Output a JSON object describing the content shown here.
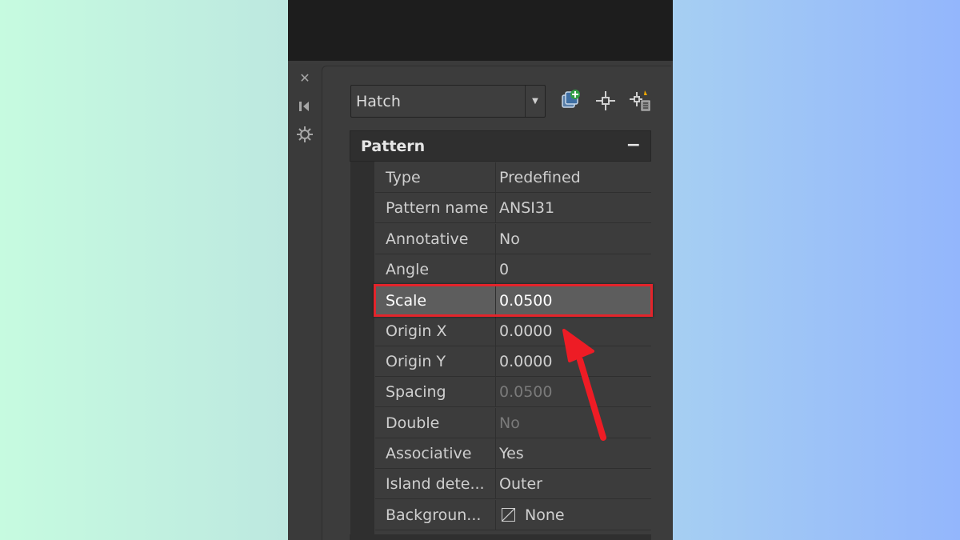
{
  "toolbar": {
    "object_type": "Hatch",
    "icons": [
      "quick-select-icon",
      "select-objects-icon",
      "toggle-pickadd-icon"
    ]
  },
  "side_strip": {
    "icons": [
      "close-icon",
      "auto-hide-icon",
      "properties-settings-icon"
    ]
  },
  "section": {
    "title": "Pattern",
    "collapse": "−"
  },
  "rows": [
    {
      "name": "Type",
      "value": "Predefined"
    },
    {
      "name": "Pattern name",
      "value": "ANSI31"
    },
    {
      "name": "Annotative",
      "value": "No"
    },
    {
      "name": "Angle",
      "value": "0"
    },
    {
      "name": "Scale",
      "value": "0.0500"
    },
    {
      "name": "Origin X",
      "value": "0.0000"
    },
    {
      "name": "Origin Y",
      "value": "0.0000"
    },
    {
      "name": "Spacing",
      "value": "0.0500"
    },
    {
      "name": "Double",
      "value": "No"
    },
    {
      "name": "Associative",
      "value": "Yes"
    },
    {
      "name": "Island dete...",
      "value": "Outer"
    },
    {
      "name": "Backgroun...",
      "value": "None"
    }
  ],
  "colors": {
    "highlight": "#e3242b",
    "arrow": "#ee1c25",
    "selected_row": "#5d5d5d"
  }
}
